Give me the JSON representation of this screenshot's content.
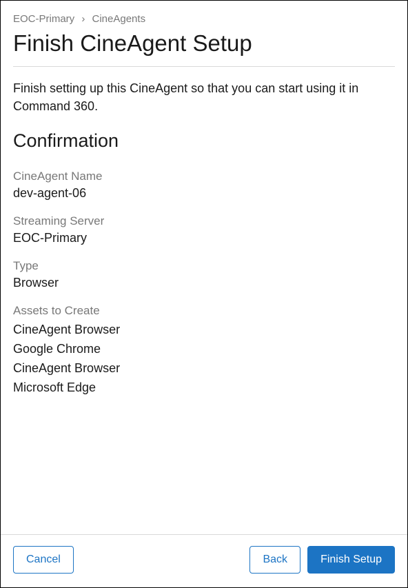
{
  "breadcrumb": {
    "parent": "EOC-Primary",
    "separator": "›",
    "current": "CineAgents"
  },
  "page_title": "Finish CineAgent Setup",
  "intro": "Finish setting up this CineAgent so that you can start using it in Command 360.",
  "section_title": "Confirmation",
  "fields": {
    "name": {
      "label": "CineAgent Name",
      "value": "dev-agent-06"
    },
    "server": {
      "label": "Streaming Server",
      "value": "EOC-Primary"
    },
    "type": {
      "label": "Type",
      "value": "Browser"
    },
    "assets": {
      "label": "Assets to Create",
      "items": [
        "CineAgent Browser",
        "Google Chrome",
        "CineAgent Browser",
        "Microsoft Edge"
      ]
    }
  },
  "buttons": {
    "cancel": "Cancel",
    "back": "Back",
    "finish": "Finish Setup"
  }
}
